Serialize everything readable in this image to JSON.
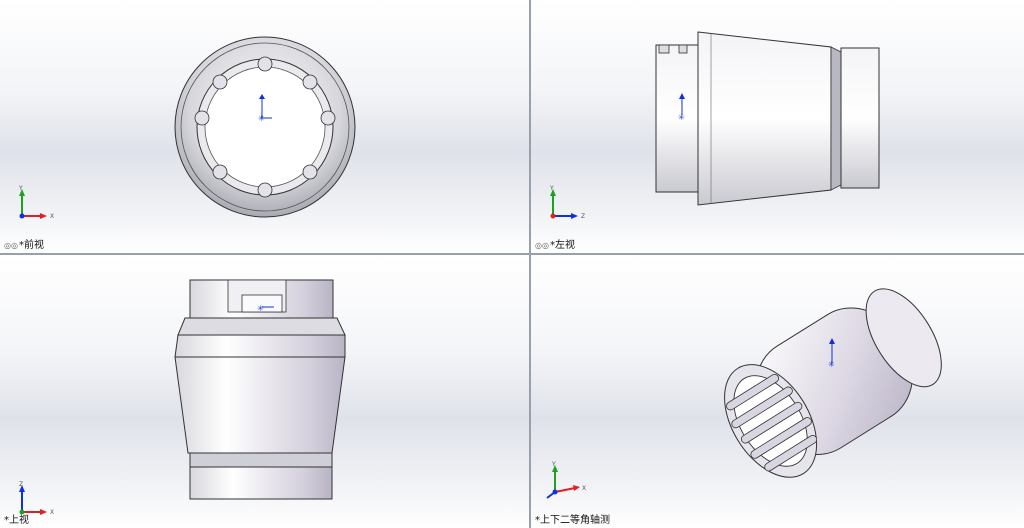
{
  "viewports": {
    "front": {
      "label": "*前视",
      "axis_up": "Y",
      "axis_right": "X"
    },
    "left": {
      "label": "*左视",
      "axis_up": "Y",
      "axis_right": "Z"
    },
    "top": {
      "label": "*上视",
      "axis_up": "Z",
      "axis_right": "X"
    },
    "iso": {
      "label": "*上下二等角轴测",
      "axis_up": "Y",
      "axis_right": "X"
    }
  },
  "colors": {
    "axis_x": "#e02020",
    "axis_y": "#20a020",
    "axis_z": "#1030e0",
    "origin": "#1030c0",
    "edge": "#333333"
  }
}
